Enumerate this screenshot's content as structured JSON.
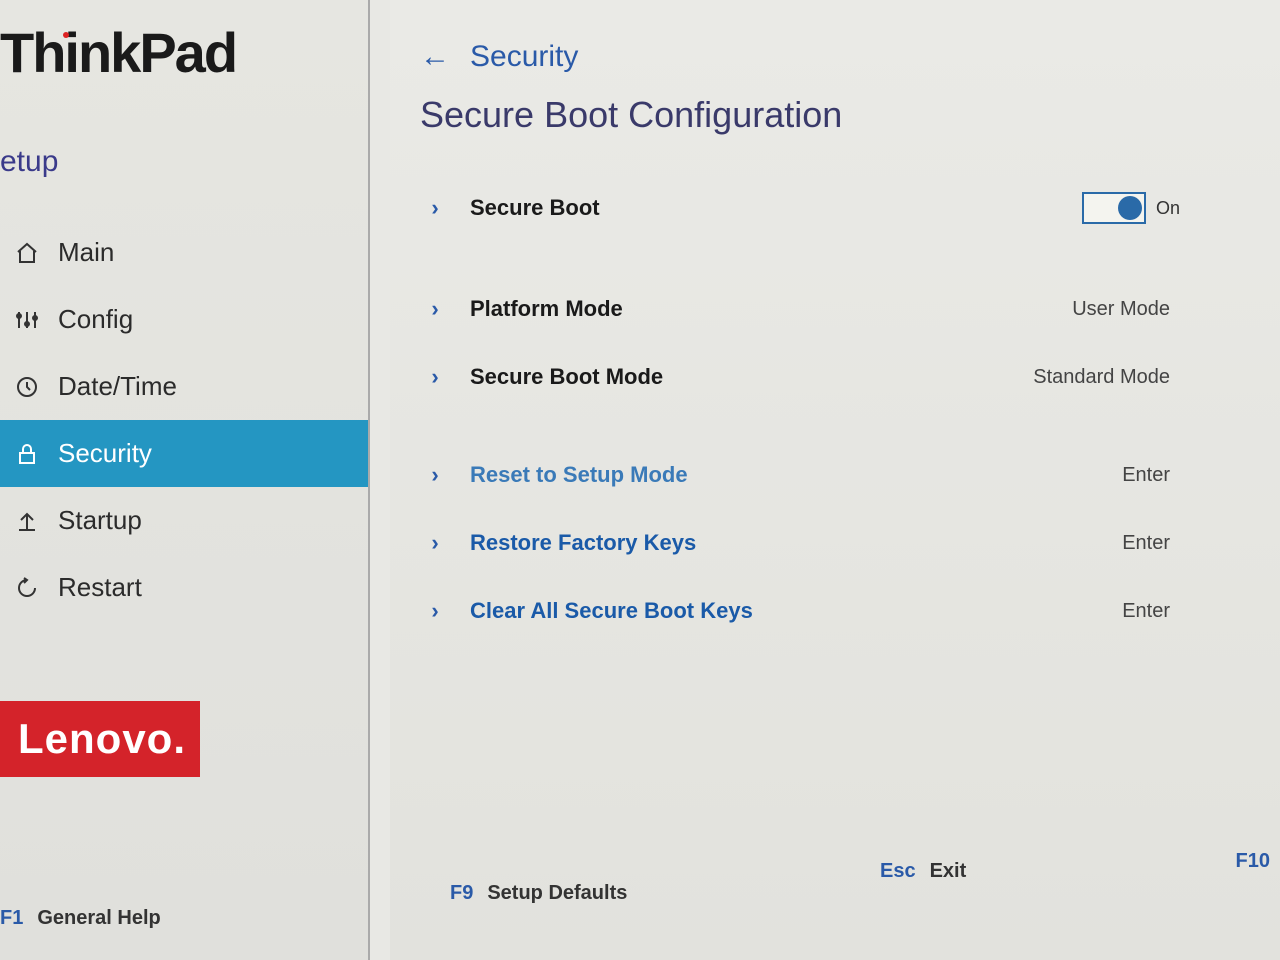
{
  "brand": "ThinkPad",
  "setup_label": "etup",
  "vendor": "Lenovo.",
  "sidebar": {
    "items": [
      {
        "label": "Main",
        "icon": "home"
      },
      {
        "label": "Config",
        "icon": "sliders"
      },
      {
        "label": "Date/Time",
        "icon": "clock"
      },
      {
        "label": "Security",
        "icon": "lock",
        "active": true
      },
      {
        "label": "Startup",
        "icon": "arrow-up"
      },
      {
        "label": "Restart",
        "icon": "refresh"
      }
    ]
  },
  "breadcrumb": {
    "label": "Security"
  },
  "page_title": "Secure Boot Configuration",
  "settings": [
    {
      "label": "Secure Boot",
      "type": "toggle",
      "value": "On"
    },
    {
      "label": "Platform Mode",
      "type": "readonly",
      "value": "User Mode"
    },
    {
      "label": "Secure Boot Mode",
      "type": "readonly",
      "value": "Standard Mode"
    }
  ],
  "actions": [
    {
      "label": "Reset to Setup Mode",
      "hint": "Enter"
    },
    {
      "label": "Restore Factory Keys",
      "hint": "Enter"
    },
    {
      "label": "Clear All Secure Boot Keys",
      "hint": "Enter"
    }
  ],
  "footer": {
    "help_key": "F1",
    "help_label": "General Help",
    "defaults_key": "F9",
    "defaults_label": "Setup Defaults",
    "exit_key": "Esc",
    "exit_label": "Exit",
    "save_key": "F10"
  }
}
